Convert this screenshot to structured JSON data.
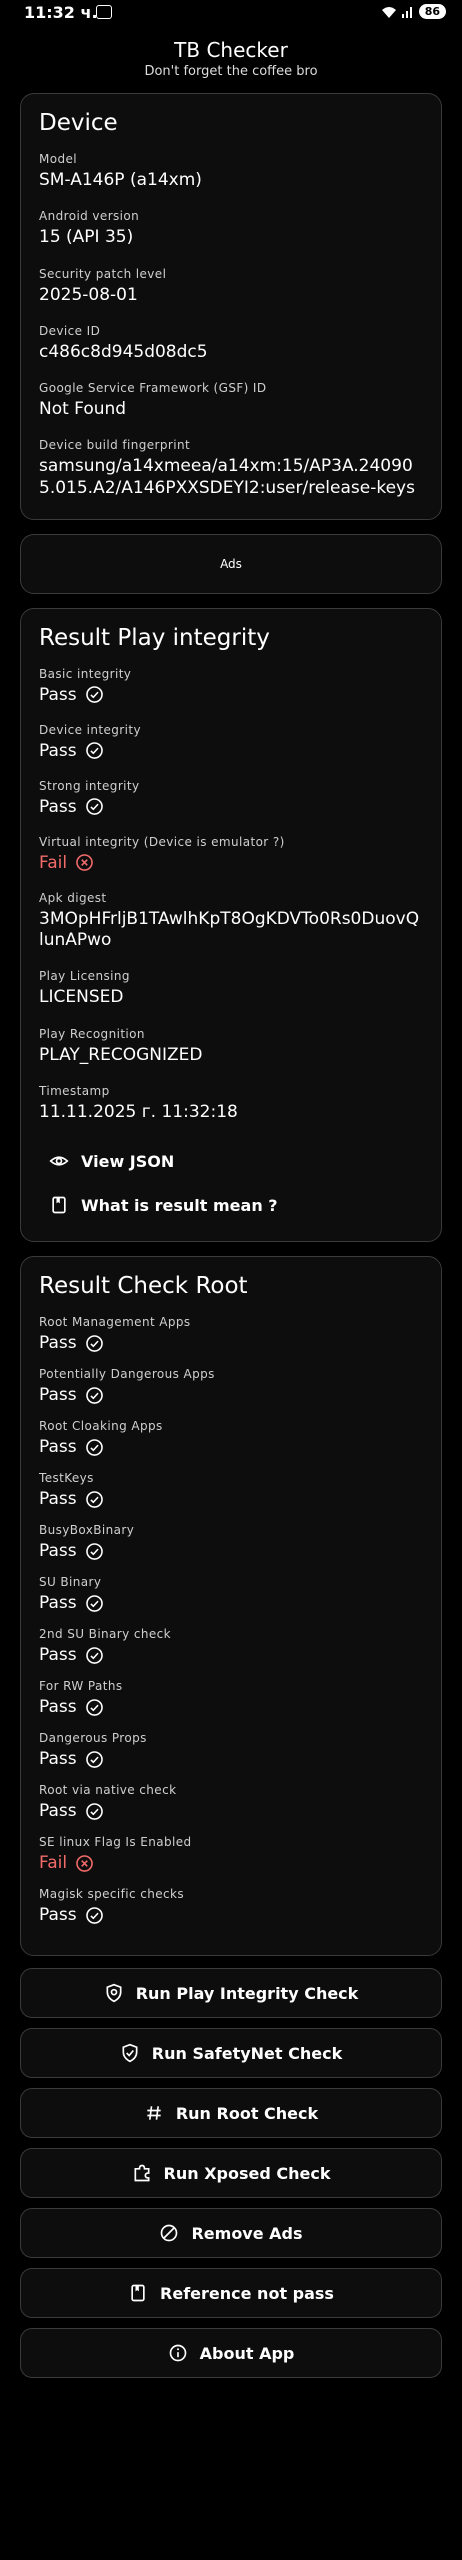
{
  "status_bar": {
    "time": "11:32 ч.",
    "battery": "86"
  },
  "header": {
    "title": "TB Checker",
    "subtitle": "Don't forget the coffee bro"
  },
  "device": {
    "title": "Device",
    "fields": [
      {
        "label": "Model",
        "value": "SM-A146P (a14xm)"
      },
      {
        "label": "Android version",
        "value": "15 (API 35)"
      },
      {
        "label": "Security patch level",
        "value": "2025-08-01"
      },
      {
        "label": "Device ID",
        "value": "c486c8d945d08dc5"
      },
      {
        "label": "Google Service Framework (GSF) ID",
        "value": "Not Found"
      },
      {
        "label": "Device build fingerprint",
        "value": "samsung/a14xmeea/a14xm:15/AP3A.240905.015.A2/A146PXXSDEYI2:user/release-keys"
      }
    ]
  },
  "ads": {
    "label": "Ads"
  },
  "play_integrity": {
    "title": "Result Play integrity",
    "checks": [
      {
        "label": "Basic integrity",
        "status": "Pass"
      },
      {
        "label": "Device integrity",
        "status": "Pass"
      },
      {
        "label": "Strong integrity",
        "status": "Pass"
      },
      {
        "label": "Virtual integrity (Device is emulator ?)",
        "status": "Fail"
      }
    ],
    "details": [
      {
        "label": "Apk digest",
        "value": "3MOpHFrljB1TAwlhKpT8OgKDVTo0Rs0DuovQlunAPwo"
      },
      {
        "label": "Play Licensing",
        "value": "LICENSED"
      },
      {
        "label": "Play Recognition",
        "value": "PLAY_RECOGNIZED"
      },
      {
        "label": "Timestamp",
        "value": "11.11.2025 г. 11:32:18"
      }
    ],
    "view_json_label": "View JSON",
    "what_mean_label": "What is result mean ?"
  },
  "root_check": {
    "title": "Result Check Root",
    "checks": [
      {
        "label": "Root Management Apps",
        "status": "Pass"
      },
      {
        "label": "Potentially Dangerous Apps",
        "status": "Pass"
      },
      {
        "label": "Root Cloaking Apps",
        "status": "Pass"
      },
      {
        "label": "TestKeys",
        "status": "Pass"
      },
      {
        "label": "BusyBoxBinary",
        "status": "Pass"
      },
      {
        "label": "SU Binary",
        "status": "Pass"
      },
      {
        "label": "2nd SU Binary check",
        "status": "Pass"
      },
      {
        "label": "For RW Paths",
        "status": "Pass"
      },
      {
        "label": "Dangerous Props",
        "status": "Pass"
      },
      {
        "label": "Root via native check",
        "status": "Pass"
      },
      {
        "label": "SE linux Flag Is Enabled",
        "status": "Fail"
      },
      {
        "label": "Magisk specific checks",
        "status": "Pass"
      }
    ]
  },
  "actions": {
    "play_integrity": "Run Play Integrity Check",
    "safetynet": "Run SafetyNet Check",
    "root": "Run Root Check",
    "xposed": "Run Xposed Check",
    "remove_ads": "Remove Ads",
    "reference": "Reference not pass",
    "about": "About App"
  }
}
